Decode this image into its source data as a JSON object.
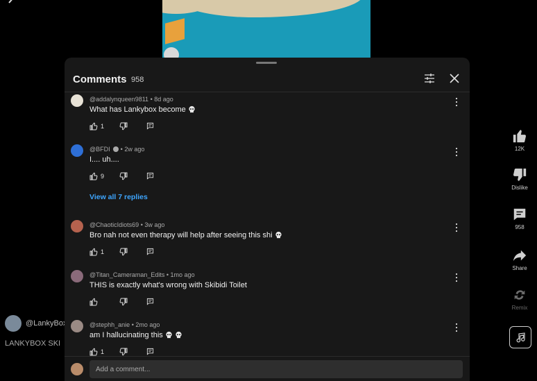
{
  "background": {
    "channel_handle": "@LankyBox",
    "video_title": "LANKYBOX SKI"
  },
  "actions": {
    "like_label": "12K",
    "dislike_label": "Dislike",
    "comments_label": "958",
    "share_label": "Share",
    "remix_label": "Remix"
  },
  "sheet": {
    "title": "Comments",
    "count": "958",
    "view_replies": "View all 7 replies",
    "input_placeholder": "Add a comment..."
  },
  "comments": [
    {
      "author": "@addalynqueen9811",
      "time": "8d ago",
      "text": "What has Lankybox become",
      "likes": "1",
      "skulls": 1
    },
    {
      "author": "@BFDI",
      "time": "2w ago",
      "text": "I.... uh....",
      "likes": "9",
      "verified": true
    },
    {
      "author": "@ChaoticIdiots69",
      "time": "3w ago",
      "text": "Bro nah not even therapy will help after seeing this shi",
      "likes": "1",
      "skulls": 1
    },
    {
      "author": "@Titan_Cameraman_Edits",
      "time": "1mo ago",
      "text": "THIS is exactly what's wrong with Skibidi Toilet",
      "likes": ""
    },
    {
      "author": "@stephh_anie",
      "time": "2mo ago",
      "text": "am I hallucinating this",
      "likes": "1",
      "skulls": 2
    }
  ],
  "meta_separator": "•",
  "colors": {
    "sheet_bg": "#181818",
    "link": "#3ea6ff",
    "input_bg": "#2e2e2e"
  }
}
